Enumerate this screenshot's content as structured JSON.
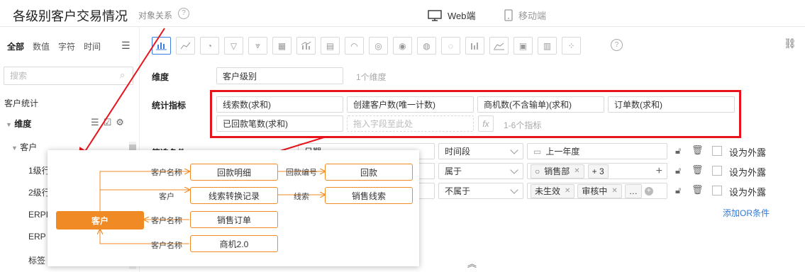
{
  "header": {
    "title": "各级别客户交易情况",
    "subtitle": "对象关系",
    "tab_web": "Web端",
    "tab_mobile": "移动端"
  },
  "left": {
    "tabs": [
      "全部",
      "数值",
      "字符",
      "时间"
    ],
    "search_placeholder": "搜索",
    "group_title": "客户统计",
    "dim_label": "维度",
    "tree_node": "客户",
    "items": [
      "1级行",
      "2级行",
      "ERPI",
      "ERP",
      "标签"
    ]
  },
  "config": {
    "dim_label": "维度",
    "dim_value": "客户级别",
    "dim_hint": "1个维度",
    "metric_label": "统计指标",
    "metrics": [
      "线索数(求和)",
      "创建客户数(唯一计数)",
      "商机数(不含输单)(求和)",
      "订单数(求和)",
      "已回款笔数(求和)"
    ],
    "metric_placeholder": "拖入字段至此处",
    "metric_hint": "1-6个指标",
    "filter_label": "筛选条件",
    "filters": [
      {
        "field": "日期",
        "op": "时间段",
        "value": "上一年度",
        "expose": "设为外露"
      },
      {
        "field": "",
        "op": "属于",
        "value_tag": "销售部",
        "more": "+ 3",
        "expose": "设为外露"
      },
      {
        "field": "",
        "op": "不属于",
        "tag1": "未生效",
        "tag2": "审核中",
        "expose": "设为外露"
      }
    ],
    "add_or": "添加OR条件"
  },
  "relation": {
    "main": "客户",
    "nodes": [
      "回款明细",
      "回款",
      "线索转换记录",
      "销售线索",
      "销售订单",
      "商机2.0"
    ],
    "edge_labels": [
      "客户名称",
      "回款编号",
      "客户",
      "线索",
      "客户名称",
      "客户名称"
    ]
  },
  "colors": {
    "accent": "#3b7fe0",
    "highlight": "#e8141c",
    "relation": "#f08a24"
  }
}
